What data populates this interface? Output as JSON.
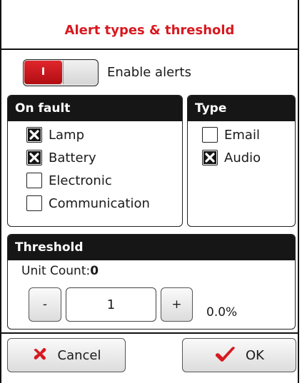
{
  "dialog": {
    "title": "Alert types & threshold"
  },
  "alerts": {
    "toggle_on_label": "I",
    "label": "Enable alerts",
    "enabled": true
  },
  "on_fault": {
    "heading": "On fault",
    "items": [
      {
        "label": "Lamp",
        "checked": true
      },
      {
        "label": "Battery",
        "checked": true
      },
      {
        "label": "Electronic",
        "checked": false
      },
      {
        "label": "Communication",
        "checked": false
      }
    ]
  },
  "type": {
    "heading": "Type",
    "items": [
      {
        "label": "Email",
        "checked": false
      },
      {
        "label": "Audio",
        "checked": true
      }
    ]
  },
  "threshold": {
    "heading": "Threshold",
    "unit_count_label": "Unit Count:",
    "unit_count_value": "0",
    "decrement_label": "-",
    "value": "1",
    "increment_label": "+",
    "percent": "0.0%"
  },
  "actions": {
    "cancel_label": "Cancel",
    "ok_label": "OK",
    "cancel_icon": "red-x-icon",
    "ok_icon": "red-check-icon"
  },
  "colors": {
    "accent": "#d71920",
    "header_bg": "#161616"
  }
}
